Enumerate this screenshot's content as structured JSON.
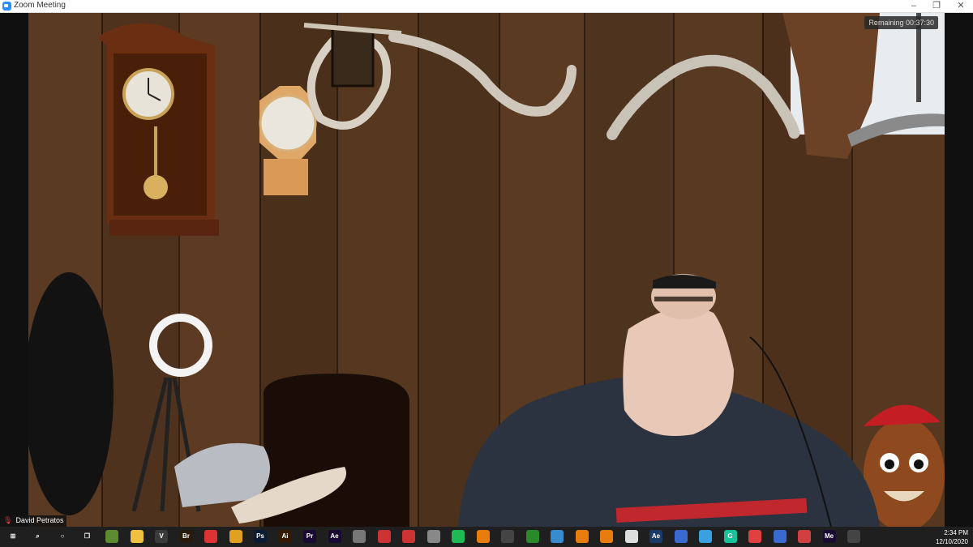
{
  "window": {
    "title": "Zoom Meeting",
    "minimize": "–",
    "restore": "❐",
    "close": "✕"
  },
  "meeting": {
    "timer": "Remaining 00:37:30",
    "participant_name": "David Petratos"
  },
  "taskbar": {
    "apps": [
      {
        "name": "windows-start",
        "label": "⊞",
        "color": "#1f1f1f"
      },
      {
        "name": "search",
        "label": "⌕",
        "color": "#1f1f1f"
      },
      {
        "name": "cortana",
        "label": "○",
        "color": "#1f1f1f"
      },
      {
        "name": "task-view",
        "label": "❐",
        "color": "#1f1f1f"
      },
      {
        "name": "minecraft",
        "label": "",
        "color": "#5c8a2e"
      },
      {
        "name": "file-explorer",
        "label": "",
        "color": "#f0c040"
      },
      {
        "name": "app-v",
        "label": "V",
        "color": "#3a3a3a"
      },
      {
        "name": "bridge",
        "label": "Br",
        "color": "#2a1a0a"
      },
      {
        "name": "chrome",
        "label": "",
        "color": "#d33"
      },
      {
        "name": "chrome-2",
        "label": "",
        "color": "#e0a020"
      },
      {
        "name": "photoshop",
        "label": "Ps",
        "color": "#0a1c33"
      },
      {
        "name": "illustrator",
        "label": "Ai",
        "color": "#331a00"
      },
      {
        "name": "premiere",
        "label": "Pr",
        "color": "#1a0a33"
      },
      {
        "name": "after-effects",
        "label": "Ae",
        "color": "#1a0a33"
      },
      {
        "name": "app-1",
        "label": "",
        "color": "#777"
      },
      {
        "name": "app-2",
        "label": "",
        "color": "#c33"
      },
      {
        "name": "app-3",
        "label": "",
        "color": "#c33"
      },
      {
        "name": "app-4",
        "label": "",
        "color": "#888"
      },
      {
        "name": "spotify",
        "label": "",
        "color": "#1db954"
      },
      {
        "name": "blender",
        "label": "",
        "color": "#e87d0d"
      },
      {
        "name": "obs",
        "label": "",
        "color": "#444"
      },
      {
        "name": "app-5",
        "label": "",
        "color": "#2a8a2a"
      },
      {
        "name": "app-6",
        "label": "",
        "color": "#3a8ad0"
      },
      {
        "name": "blender-2",
        "label": "",
        "color": "#e87d0d"
      },
      {
        "name": "blender-3",
        "label": "",
        "color": "#e87d0d"
      },
      {
        "name": "notepad",
        "label": "",
        "color": "#ddd"
      },
      {
        "name": "app-ae",
        "label": "Ae",
        "color": "#1a3a6a"
      },
      {
        "name": "app-7",
        "label": "",
        "color": "#3a6ad0"
      },
      {
        "name": "app-8",
        "label": "",
        "color": "#3aa0e0"
      },
      {
        "name": "grammarly",
        "label": "G",
        "color": "#15c39a"
      },
      {
        "name": "app-9",
        "label": "",
        "color": "#e04040"
      },
      {
        "name": "app-10",
        "label": "",
        "color": "#3a6ad0"
      },
      {
        "name": "app-11",
        "label": "",
        "color": "#d04040"
      },
      {
        "name": "media-encoder",
        "label": "Me",
        "color": "#1a0a33"
      },
      {
        "name": "app-12",
        "label": "",
        "color": "#444"
      }
    ],
    "time": "2:34 PM",
    "date": "12/10/2020"
  }
}
